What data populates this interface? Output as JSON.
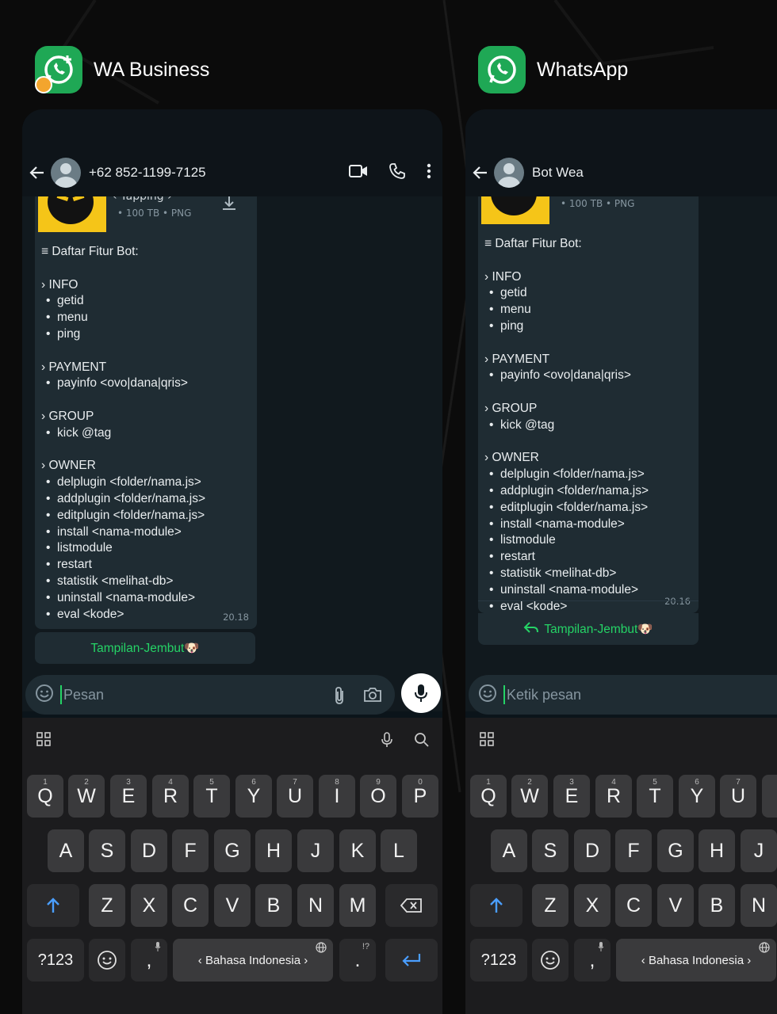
{
  "apps": [
    {
      "name": "WA Business",
      "chat": {
        "title": "+62 852-1199-7125",
        "doc_title": "‹ Yapping ›",
        "doc_meta": "• 100 TB • PNG",
        "heading": "≡ Daftar Fitur Bot:",
        "time": "20.18",
        "button": "Tampilan-Jembut🐶",
        "input_placeholder": "Pesan"
      }
    },
    {
      "name": "WhatsApp",
      "chat": {
        "title": "Bot Wea",
        "doc_meta": "• 100 TB • PNG",
        "heading": "≡ Daftar Fitur Bot:",
        "time": "20.16",
        "button": "Tampilan-Jembut🐶",
        "input_placeholder": "Ketik pesan"
      }
    }
  ],
  "sections": [
    {
      "title": "› INFO",
      "items": [
        "getid",
        "menu",
        "ping"
      ]
    },
    {
      "title": "› PAYMENT",
      "items": [
        "payinfo <ovo|dana|qris>"
      ]
    },
    {
      "title": "› GROUP",
      "items": [
        "kick @tag"
      ]
    },
    {
      "title": "› OWNER",
      "items": [
        "delplugin <folder/nama.js>",
        "addplugin <folder/nama.js>",
        "editplugin <folder/nama.js>",
        "install <nama-module>",
        "listmodule",
        "restart",
        "statistik <melihat-db>",
        "uninstall <nama-module>",
        "eval <kode>"
      ]
    }
  ],
  "keyboard": {
    "row1": [
      "Q",
      "W",
      "E",
      "R",
      "T",
      "Y",
      "U",
      "I",
      "O",
      "P"
    ],
    "row1_nums": [
      "1",
      "2",
      "3",
      "4",
      "5",
      "6",
      "7",
      "8",
      "9",
      "0"
    ],
    "row2": [
      "A",
      "S",
      "D",
      "F",
      "G",
      "H",
      "J",
      "K",
      "L"
    ],
    "row3": [
      "Z",
      "X",
      "C",
      "V",
      "B",
      "N",
      "M"
    ],
    "sym": "?123",
    "comma": ",",
    "period": ".",
    "period_alt": "!?",
    "space": "Bahasa Indonesia",
    "space_arrow_left": "‹",
    "space_arrow_right": "›"
  },
  "colors": {
    "accent": "#25d366",
    "bubble": "#1f2c33",
    "chat_bg": "#11191e",
    "key": "#3a3a3c",
    "shift_icon": "#4a9eff"
  },
  "icons": [
    "back-arrow-icon",
    "video-call-icon",
    "phone-icon",
    "more-vert-icon",
    "download-icon",
    "sticker-icon",
    "attach-icon",
    "camera-icon",
    "mic-icon",
    "grid-icon",
    "search-icon",
    "shift-icon",
    "backspace-icon",
    "emoji-icon",
    "globe-icon",
    "enter-icon",
    "reply-icon"
  ]
}
